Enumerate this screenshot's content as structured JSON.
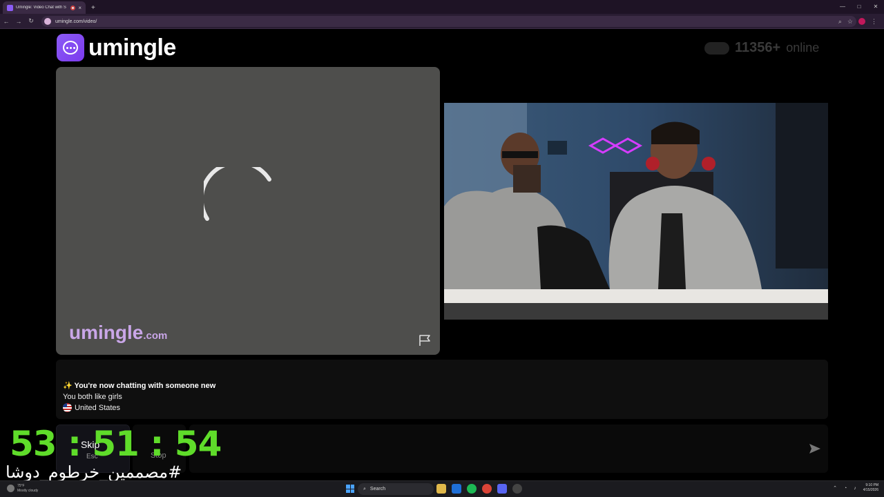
{
  "browser": {
    "tab_title": "Umingle: Video Chat with S",
    "url": "umingle.com/video/",
    "new_tab": "+",
    "close_tab": "×",
    "controls": [
      "—",
      "□",
      "✕"
    ]
  },
  "site": {
    "logo_text": "umingle",
    "online_count": "11356+",
    "online_label": "online",
    "watermark_main": "umingle",
    "watermark_tld": ".com"
  },
  "chat": {
    "line1": "✨ You're now chatting with someone new",
    "line2": "You both like girls",
    "country": "United States"
  },
  "controls": {
    "skip_label": "Skip",
    "skip_hotkey": "Esc",
    "stop_label": "Stop",
    "input_placeholder": ""
  },
  "overlay": {
    "timer": "53 : 51 : 54",
    "hashtag": "#مصممين_خرطوم_دوشا"
  },
  "taskbar": {
    "weather_temp": "75°F",
    "weather_desc": "Mostly cloudy",
    "search_label": "Search",
    "time": "9:10 PM",
    "date": "4/15/2026"
  },
  "colors": {
    "accent": "#8b5cf6",
    "timer": "#5fdc2a",
    "remote_bg": "#4e4e4c"
  }
}
